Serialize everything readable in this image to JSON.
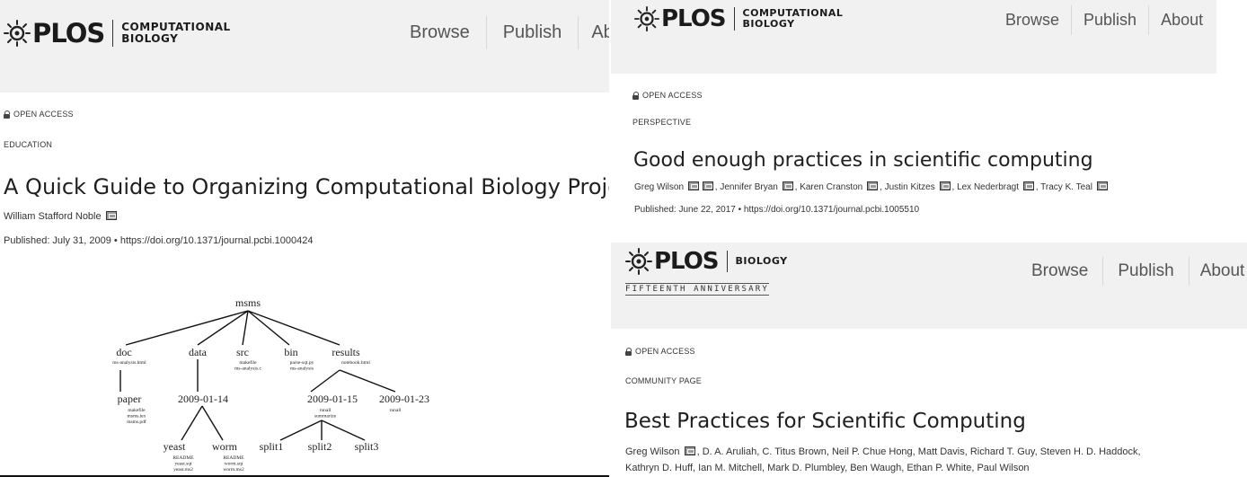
{
  "left_panel": {
    "logo": {
      "brand": "PLOS",
      "journal": "COMPUTATIONAL\nBIOLOGY"
    },
    "nav": [
      "Browse",
      "Publish",
      "Abc"
    ],
    "open_access": "OPEN ACCESS",
    "article_type": "EDUCATION",
    "title": "A Quick Guide to Organizing Computational Biology Projects",
    "author": "William Stafford Noble",
    "published": "Published: July 31, 2009 •  https://doi.org/10.1371/journal.pcbi.1000424",
    "figure": {
      "root": "msms",
      "level1": [
        "doc",
        "data",
        "src",
        "bin",
        "results"
      ],
      "level1_files": [
        "ms-analysis.html",
        "",
        "makefile\nms-analysis.c",
        "parse-sqt.py\nms-analysis",
        "notebook.html"
      ],
      "level2": [
        "paper",
        "2009-01-14",
        "2009-01-15",
        "2009-01-23"
      ],
      "level2_files": [
        "makefile\nmsms.tex\nmsms.pdf",
        "",
        "runall\nsummarize",
        "runall"
      ],
      "level3": [
        "yeast",
        "worm",
        "split1",
        "split2",
        "split3"
      ],
      "level3_files": [
        "README\nyeast.sqt\nyeast.ms2",
        "README\nworm.sqt\nworm.ms2",
        "",
        "",
        ""
      ]
    }
  },
  "right_top": {
    "logo": {
      "brand": "PLOS",
      "journal": "COMPUTATIONAL\nBIOLOGY"
    },
    "nav": [
      "Browse",
      "Publish",
      "About"
    ],
    "open_access": "OPEN ACCESS",
    "article_type": "PERSPECTIVE",
    "title": "Good enough practices in scientific computing",
    "authors": [
      "Greg Wilson",
      "Jennifer Bryan",
      "Karen Cranston",
      "Justin Kitzes",
      "Lex Nederbragt",
      "Tracy K. Teal"
    ],
    "published": "Published: June 22, 2017 •  https://doi.org/10.1371/journal.pcbi.1005510"
  },
  "right_bottom": {
    "logo": {
      "brand": "PLOS",
      "journal": "BIOLOGY",
      "tagline": "FIFTEENTH ANNIVERSARY"
    },
    "nav": [
      "Browse",
      "Publish",
      "About"
    ],
    "open_access": "OPEN ACCESS",
    "article_type": "COMMUNITY PAGE",
    "title": "Best Practices for Scientific Computing",
    "authors_line1_first": "Greg Wilson",
    "authors_line1_rest": ", D. A. Aruliah, C. Titus Brown, Neil P. Chue Hong, Matt Davis, Richard T. Guy, Steven H. D. Haddock,",
    "authors_line2": "Kathryn D. Huff, Ian M. Mitchell, Mark D. Plumbley, Ben Waugh, Ethan P. White, Paul Wilson"
  }
}
